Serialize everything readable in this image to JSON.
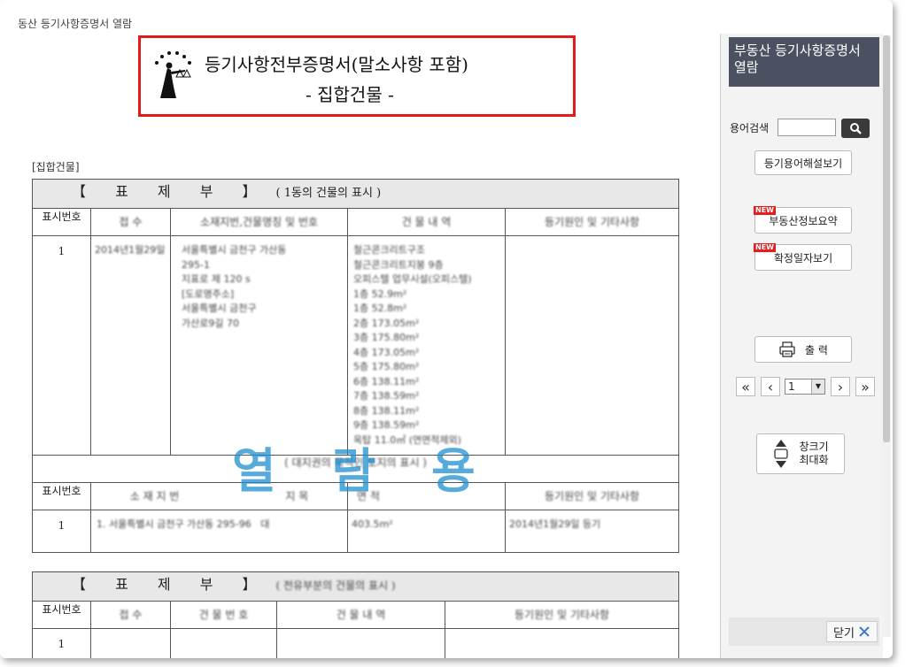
{
  "window": {
    "title": "동산 등기사항증명서 열람"
  },
  "document": {
    "title_main": "등기사항전부증명서(말소사항 포함)",
    "title_sub": "- 집합건물 -",
    "section_label": "[집합건물]",
    "watermark": "열 람 용",
    "table1": {
      "header_title": "【 표 제 부 】",
      "header_sub": "( 1동의 건물의 표시 )",
      "col_number": "표시번호",
      "col_receipt": "접 수",
      "col_location": "소재지번,건물명칭 및 번호",
      "col_detail": "건 물 내 역",
      "col_cause": "등기원인 및 기타사항",
      "row_number": "1",
      "row_receipt": "2014년1월29일",
      "row_location_lines": [
        "서울특별시 금천구 가산동",
        "295-1",
        "지표로 제 120 s",
        "[도로명주소]",
        "서울특별시 금천구",
        "가산로9길 70"
      ],
      "row_detail_lines": [
        "철근콘크리트구조",
        "철근콘크리트지붕 9층",
        "오피스텔 업무시설(오피스텔)",
        "1층 52.9m²",
        "1층 52.8m²",
        "2층 173.05m²",
        "3층 175.80m²",
        "4층 173.05m²",
        "5층 175.80m²",
        "6층 138.11m²",
        "7층 138.59m²",
        "8층 138.11m²",
        "9층 138.59m²",
        "옥탑 11.0㎡ (연면적제외)"
      ],
      "mid_label": "( 대지권의 목적인 토지의 표시 )",
      "col2_number": "표시번호",
      "col2_location": "소 재 지 번",
      "col2_category": "지 목",
      "col2_area": "면 적",
      "col2_cause": "등기원인 및 기타사항",
      "row2_number": "1",
      "row2_location": "1. 서울특별시 금천구 가산동 295-96",
      "row2_category": "대",
      "row2_area": "403.5m²",
      "row2_cause": "2014년1월29일 등기"
    },
    "table2": {
      "header_title": "【 표 제 부 】",
      "header_sub": "( 전유부분의 건물의 표시 )",
      "col_number": "표시번호",
      "col_receipt": "접 수",
      "col_number2": "건 물 번 호",
      "col_detail": "건 물 내 역",
      "col_cause": "등기원인 및 기타사항",
      "row_number": "1"
    }
  },
  "panel": {
    "header": "부동산 등기사항증명서 열람",
    "term_search_label": "용어검색",
    "term_input_value": "",
    "term_button_icon": "search-icon",
    "glossary_button": "등기용어해설보기",
    "new_badge": "NEW",
    "summary_button": "부동산정보요약",
    "date_button": "확정일자보기",
    "print_button": "출 력",
    "page_value": "1",
    "resize_button_line1": "창크기",
    "resize_button_line2": "최대화",
    "close_button": "닫기"
  }
}
